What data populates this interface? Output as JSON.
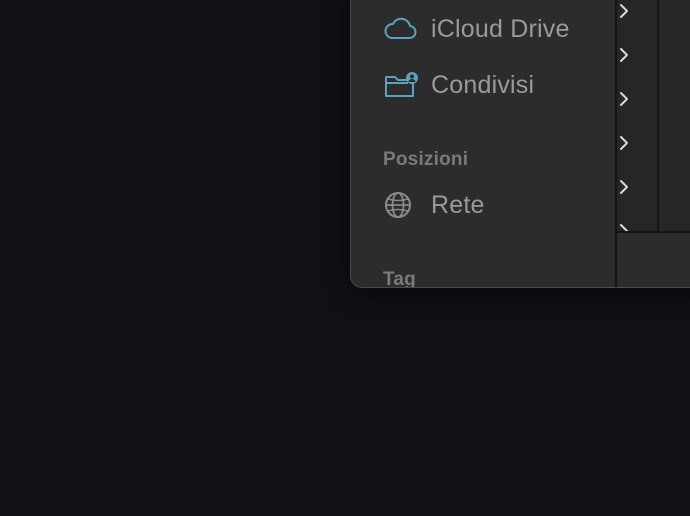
{
  "sidebar": {
    "items": [
      {
        "label": "iCloud Drive",
        "icon": "cloud-icon"
      },
      {
        "label": "Condivisi",
        "icon": "shared-folder-icon"
      }
    ],
    "sections": [
      {
        "title": "Posizioni",
        "items": [
          {
            "label": "Rete",
            "icon": "network-globe-icon"
          }
        ]
      },
      {
        "title": "Tag",
        "items": []
      }
    ]
  },
  "colors": {
    "desktop": "#101115",
    "window": "#2c2c2d",
    "sidebar_label": "#9a9a9c",
    "section_header": "#7a7a7d",
    "icon_accent": "#5aa3bf"
  }
}
